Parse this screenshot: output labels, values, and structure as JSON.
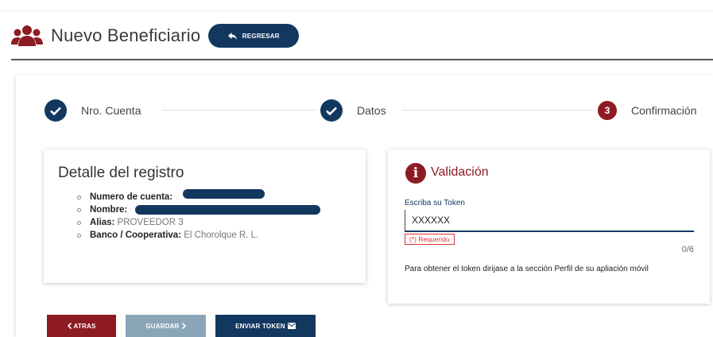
{
  "header": {
    "title": "Nuevo Beneficiario",
    "back_label": "REGRESAR",
    "icon": "users-icon",
    "accent_color": "#8e1b23",
    "primary_color": "#12385f"
  },
  "stepper": {
    "steps": [
      {
        "label": "Nro. Cuenta",
        "state": "done",
        "icon": "check-icon"
      },
      {
        "label": "Datos",
        "state": "done",
        "icon": "check-icon"
      },
      {
        "number": "3",
        "label": "Confirmación",
        "state": "active"
      }
    ]
  },
  "detail": {
    "title": "Detalle del registro",
    "items": [
      {
        "label": "Numero de cuenta:",
        "value": "",
        "redacted": true
      },
      {
        "label": "Nombre:",
        "value": "",
        "redacted": true
      },
      {
        "label": "Alias:",
        "value": "PROVEEDOR 3"
      },
      {
        "label": "Banco / Cooperativa:",
        "value": "El Chorolque R. L."
      }
    ]
  },
  "validation": {
    "icon": "info-icon",
    "title": "Validación",
    "field_label": "Escriba su Token",
    "field_value": "XXXXXX",
    "required_text": "(*) Requerido",
    "counter": "0/6",
    "hint": "Para obtener el token dirijase a la sección Perfil de su apliación móvil"
  },
  "actions": {
    "back_label": "ATRAS",
    "save_label": "GUARDAR",
    "send_token_label": "ENVIAR TOKEN"
  }
}
